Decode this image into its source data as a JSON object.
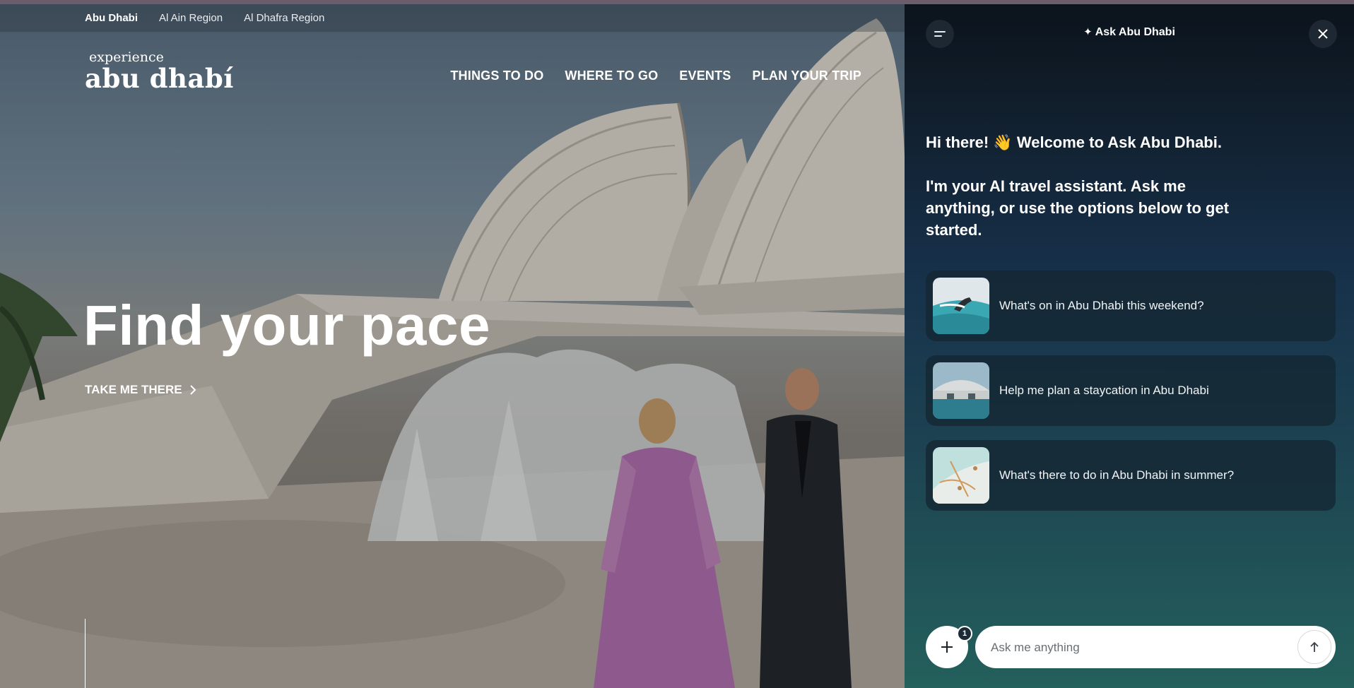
{
  "regions": [
    {
      "label": "Abu Dhabi",
      "active": true
    },
    {
      "label": "Al Ain Region",
      "active": false
    },
    {
      "label": "Al Dhafra Region",
      "active": false
    }
  ],
  "logo": {
    "top": "experience",
    "bottom": "abu dhabí"
  },
  "nav": [
    "THINGS TO DO",
    "WHERE TO GO",
    "EVENTS",
    "PLAN YOUR TRIP"
  ],
  "hero": {
    "title": "Find your pace",
    "cta": "TAKE ME THERE"
  },
  "chat": {
    "title": "Ask Abu Dhabi",
    "greeting": "Hi there! 👋 Welcome to Ask Abu Dhabi.",
    "intro": "I'm your AI travel assistant. Ask me anything, or use the options below to get started.",
    "suggestions": [
      {
        "text": "What's on in Abu Dhabi this weekend?",
        "thumb": "surfing-image"
      },
      {
        "text": "Help me plan a staycation in Abu Dhabi",
        "thumb": "museum-dome-image"
      },
      {
        "text": "What's there to do in Abu Dhabi in summer?",
        "thumb": "map-image"
      }
    ],
    "input_placeholder": "Ask me anything",
    "attach_badge": "1"
  },
  "colors": {
    "panel_top": "#0b131c",
    "panel_bottom": "#24605c",
    "card": "#142632"
  }
}
